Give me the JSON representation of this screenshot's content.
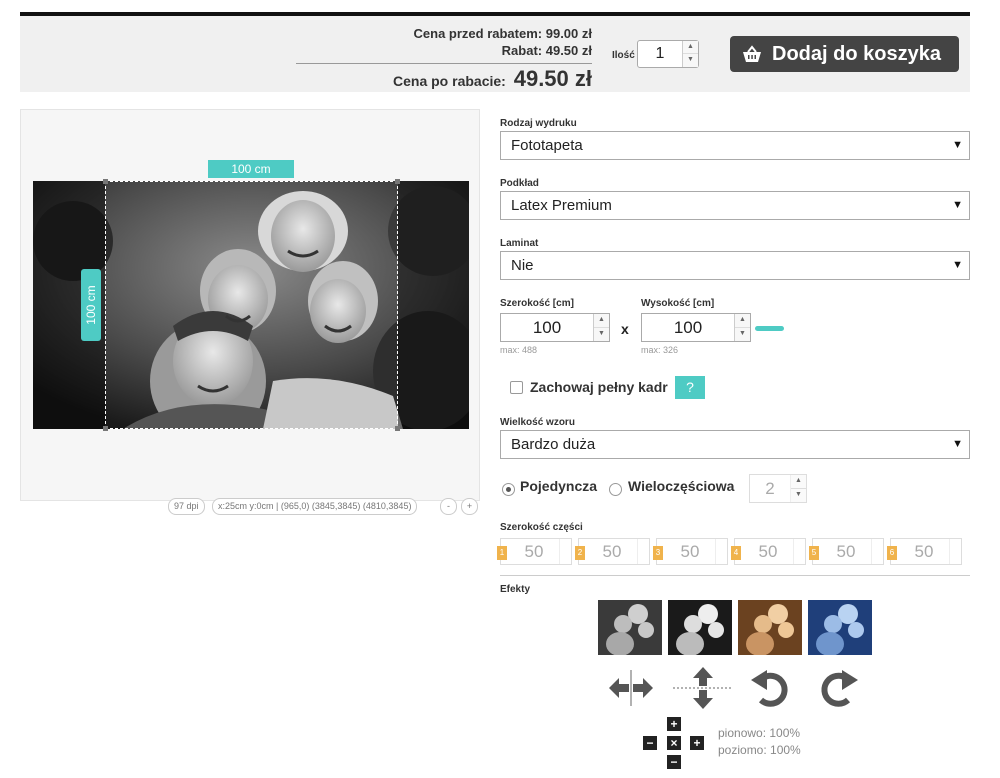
{
  "pricing": {
    "before_label": "Cena przed rabatem:",
    "before_value": "99.00 zł",
    "discount_label": "Rabat:",
    "discount_value": "49.50 zł",
    "after_label": "Cena po rabacie:",
    "after_value": "49.50 zł"
  },
  "quantity": {
    "label": "Ilość",
    "value": "1"
  },
  "cart": {
    "label": "Dodaj do koszyka",
    "icon": "basket-icon"
  },
  "preview": {
    "width_label": "100 cm",
    "height_label": "100 cm",
    "dpi": "97 dpi",
    "coords": "x:25cm y:0cm | (965,0) (3845,3845) (4810,3845)",
    "zoom_out": "-",
    "zoom_in": "+"
  },
  "form": {
    "print_type": {
      "label": "Rodzaj wydruku",
      "value": "Fototapeta"
    },
    "substrate": {
      "label": "Podkład",
      "value": "Latex Premium"
    },
    "laminate": {
      "label": "Laminat",
      "value": "Nie"
    },
    "width": {
      "label": "Szerokość [cm]",
      "value": "100",
      "max": "max: 488"
    },
    "height": {
      "label": "Wysokość [cm]",
      "value": "100",
      "max": "max: 326"
    },
    "times": "x",
    "keep_frame": {
      "label": "Zachowaj pełny kadr",
      "checked": false,
      "help": "?"
    },
    "pattern_size": {
      "label": "Wielkość wzoru",
      "value": "Bardzo duża"
    },
    "layout": {
      "single": "Pojedyncza",
      "multi": "Wieloczęściowa",
      "selected": "single",
      "parts": "2"
    },
    "part_width": {
      "label": "Szerokość części",
      "parts": [
        {
          "n": "1",
          "value": "50"
        },
        {
          "n": "2",
          "value": "50"
        },
        {
          "n": "3",
          "value": "50"
        },
        {
          "n": "4",
          "value": "50"
        },
        {
          "n": "5",
          "value": "50"
        },
        {
          "n": "6",
          "value": "50"
        }
      ]
    }
  },
  "effects": {
    "label": "Efekty",
    "thumbs": [
      "grayscale",
      "grayscale-contrast",
      "sepia",
      "blue-tint"
    ],
    "tools": [
      "flip-horizontal-icon",
      "flip-vertical-icon",
      "rotate-left-icon",
      "rotate-right-icon"
    ]
  },
  "scale": {
    "vertical": "pionowo: 100%",
    "horizontal": "poziomo: 100%"
  },
  "colors": {
    "accent": "#4ecbc4",
    "button": "#444444",
    "part_badge": "#f0b34c"
  }
}
